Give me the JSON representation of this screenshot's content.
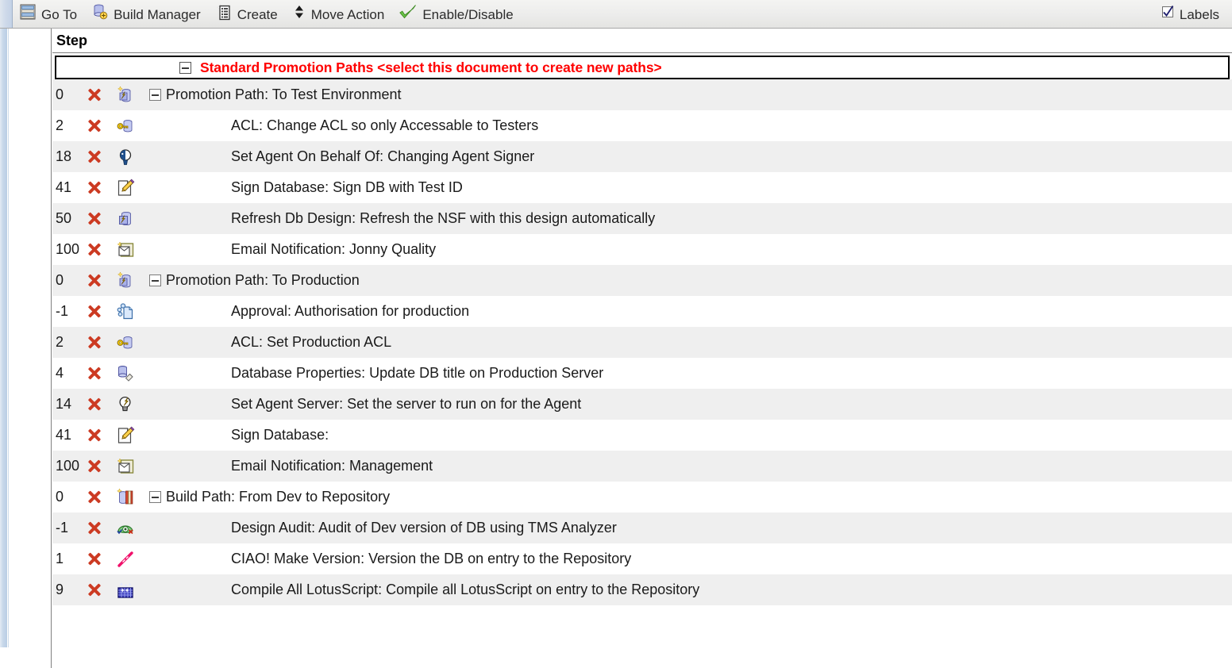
{
  "toolbar": {
    "items": [
      {
        "label": "Go To",
        "icon": "list-view-icon"
      },
      {
        "label": "Build Manager",
        "icon": "build-manager-icon"
      },
      {
        "label": "Create",
        "icon": "create-document-icon"
      },
      {
        "label": "Move Action",
        "icon": "move-updown-icon"
      },
      {
        "label": "Enable/Disable",
        "icon": "green-check-icon"
      }
    ],
    "labels_toggle": {
      "label": "Labels",
      "icon": "checkbox-checked-icon",
      "checked": true
    }
  },
  "view": {
    "columns": [
      {
        "key": "step",
        "label": "Step"
      },
      {
        "key": "del",
        "label": ""
      },
      {
        "key": "icon",
        "label": ""
      },
      {
        "key": "title",
        "label": ""
      }
    ],
    "selected_document": {
      "title": "Standard Promotion Paths <select this document to create new paths>",
      "color": "#ff0000",
      "twisty": "collapse-twisty-icon",
      "selected": true
    },
    "rows": [
      {
        "step": "0",
        "title": "Promotion Path: To Test Environment",
        "icon": "promotion-path-icon",
        "level": 0,
        "twisty": true,
        "delete": "delete-x-icon",
        "shade": "alt"
      },
      {
        "step": "2",
        "title": "ACL: Change ACL so only Accessable to Testers",
        "icon": "acl-key-icon",
        "level": 1,
        "twisty": false,
        "delete": "delete-x-icon",
        "shade": "plain"
      },
      {
        "step": "18",
        "title": "Set Agent On Behalf Of: Changing Agent Signer",
        "icon": "agent-signer-icon",
        "level": 1,
        "twisty": false,
        "delete": "delete-x-icon",
        "shade": "alt"
      },
      {
        "step": "41",
        "title": "Sign Database: Sign DB with Test ID",
        "icon": "sign-database-icon",
        "level": 1,
        "twisty": false,
        "delete": "delete-x-icon",
        "shade": "plain"
      },
      {
        "step": "50",
        "title": "Refresh Db Design: Refresh the NSF with this design automatically",
        "icon": "refresh-design-icon",
        "level": 1,
        "twisty": false,
        "delete": "delete-x-icon",
        "shade": "alt"
      },
      {
        "step": "100",
        "title": "Email Notification: Jonny Quality",
        "icon": "email-notification-icon",
        "level": 1,
        "twisty": false,
        "delete": "delete-x-icon",
        "shade": "plain"
      },
      {
        "step": "0",
        "title": "Promotion Path: To Production",
        "icon": "promotion-path-icon",
        "level": 0,
        "twisty": true,
        "delete": "delete-x-icon",
        "shade": "alt"
      },
      {
        "step": "-1",
        "title": "Approval: Authorisation for production",
        "icon": "approval-icon",
        "level": 1,
        "twisty": false,
        "delete": "delete-x-icon",
        "shade": "plain"
      },
      {
        "step": "2",
        "title": "ACL: Set Production ACL",
        "icon": "acl-key-icon",
        "level": 1,
        "twisty": false,
        "delete": "delete-x-icon",
        "shade": "alt"
      },
      {
        "step": "4",
        "title": "Database Properties: Update DB title on Production Server",
        "icon": "database-properties-icon",
        "level": 1,
        "twisty": false,
        "delete": "delete-x-icon",
        "shade": "plain"
      },
      {
        "step": "14",
        "title": "Set Agent Server: Set the server to run on for the Agent",
        "icon": "agent-bulb-icon",
        "level": 1,
        "twisty": false,
        "delete": "delete-x-icon",
        "shade": "alt"
      },
      {
        "step": "41",
        "title": "Sign Database:",
        "icon": "sign-database-icon",
        "level": 1,
        "twisty": false,
        "delete": "delete-x-icon",
        "shade": "plain"
      },
      {
        "step": "100",
        "title": "Email Notification: Management",
        "icon": "email-notification-icon",
        "level": 1,
        "twisty": false,
        "delete": "delete-x-icon",
        "shade": "alt"
      },
      {
        "step": "0",
        "title": "Build Path: From Dev to Repository",
        "icon": "build-path-icon",
        "level": 0,
        "twisty": true,
        "delete": "delete-x-icon",
        "shade": "plain"
      },
      {
        "step": "-1",
        "title": "Design Audit: Audit of Dev version of DB using TMS Analyzer",
        "icon": "design-audit-icon",
        "level": 1,
        "twisty": false,
        "delete": "delete-x-icon",
        "shade": "alt"
      },
      {
        "step": "1",
        "title": "CIAO! Make Version: Version the DB on entry to the Repository",
        "icon": "ciao-version-icon",
        "level": 1,
        "twisty": false,
        "delete": "delete-x-icon",
        "shade": "plain"
      },
      {
        "step": "9",
        "title": "Compile All LotusScript: Compile all LotusScript on entry to the Repository",
        "icon": "compile-lotusscript-icon",
        "level": 1,
        "twisty": false,
        "delete": "delete-x-icon",
        "shade": "alt"
      }
    ]
  },
  "colors": {
    "selected_text": "#ff0000",
    "row_alt": "#efefef",
    "row_plain": "#ffffff",
    "toolbar_bg": "#ececeb",
    "grid_line": "#808080",
    "delete_x": "#cc3a22"
  }
}
